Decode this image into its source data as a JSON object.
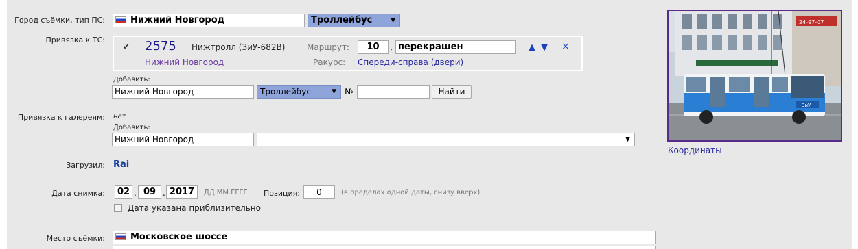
{
  "labels": {
    "city_type": "Город съёмки, тип ПС:",
    "vehicle_link": "Привязка к ТС:",
    "gallery_link": "Привязка к галереям:",
    "uploaded_by": "Загрузил:",
    "photo_date": "Дата снимка:",
    "location": "Место съёмки:"
  },
  "city": {
    "value": "Нижний Новгород"
  },
  "vehicle_type": {
    "value": "Троллейбус"
  },
  "vehicle": {
    "number": "2575",
    "model": "Нижтролл (ЗиУ-682В)",
    "route_label": "Маршрут:",
    "route_number": "10",
    "route_comma": ",",
    "route_note": "перекрашен",
    "city": "Нижний Новгород",
    "angle_label": "Ракурс:",
    "angle_value": "Спереди-справа (двери)",
    "move_up": "▲",
    "move_down": "▼",
    "remove": "×"
  },
  "add_vehicle": {
    "label": "Добавить:",
    "city": "Нижний Новгород",
    "type": "Троллейбус",
    "number_label": "№",
    "number_value": "",
    "find_button": "Найти"
  },
  "gallery": {
    "value": "нет",
    "add_label": "Добавить:",
    "city": "Нижний Новгород",
    "gallery_select": ""
  },
  "uploader": "Rai",
  "date": {
    "day": "02",
    "month": "09",
    "year": "2017",
    "dot1": ".",
    "dot2": ".",
    "format_hint": "ДД.ММ.ГГГГ",
    "position_label": "Позиция:",
    "position_value": "0",
    "position_hint": "(в пределах одной даты, снизу вверх)",
    "approx_label": "Дата указана приблизительно"
  },
  "location": {
    "value": "Московское шоссе"
  },
  "photo": {
    "coords_link": "Координаты",
    "sign1": "24-97-07",
    "sign2": "ЗиУ"
  },
  "colors": {
    "select_blue": "#8ea4da",
    "link": "#2a2aa0",
    "bus_blue": "#2a7fd4"
  }
}
